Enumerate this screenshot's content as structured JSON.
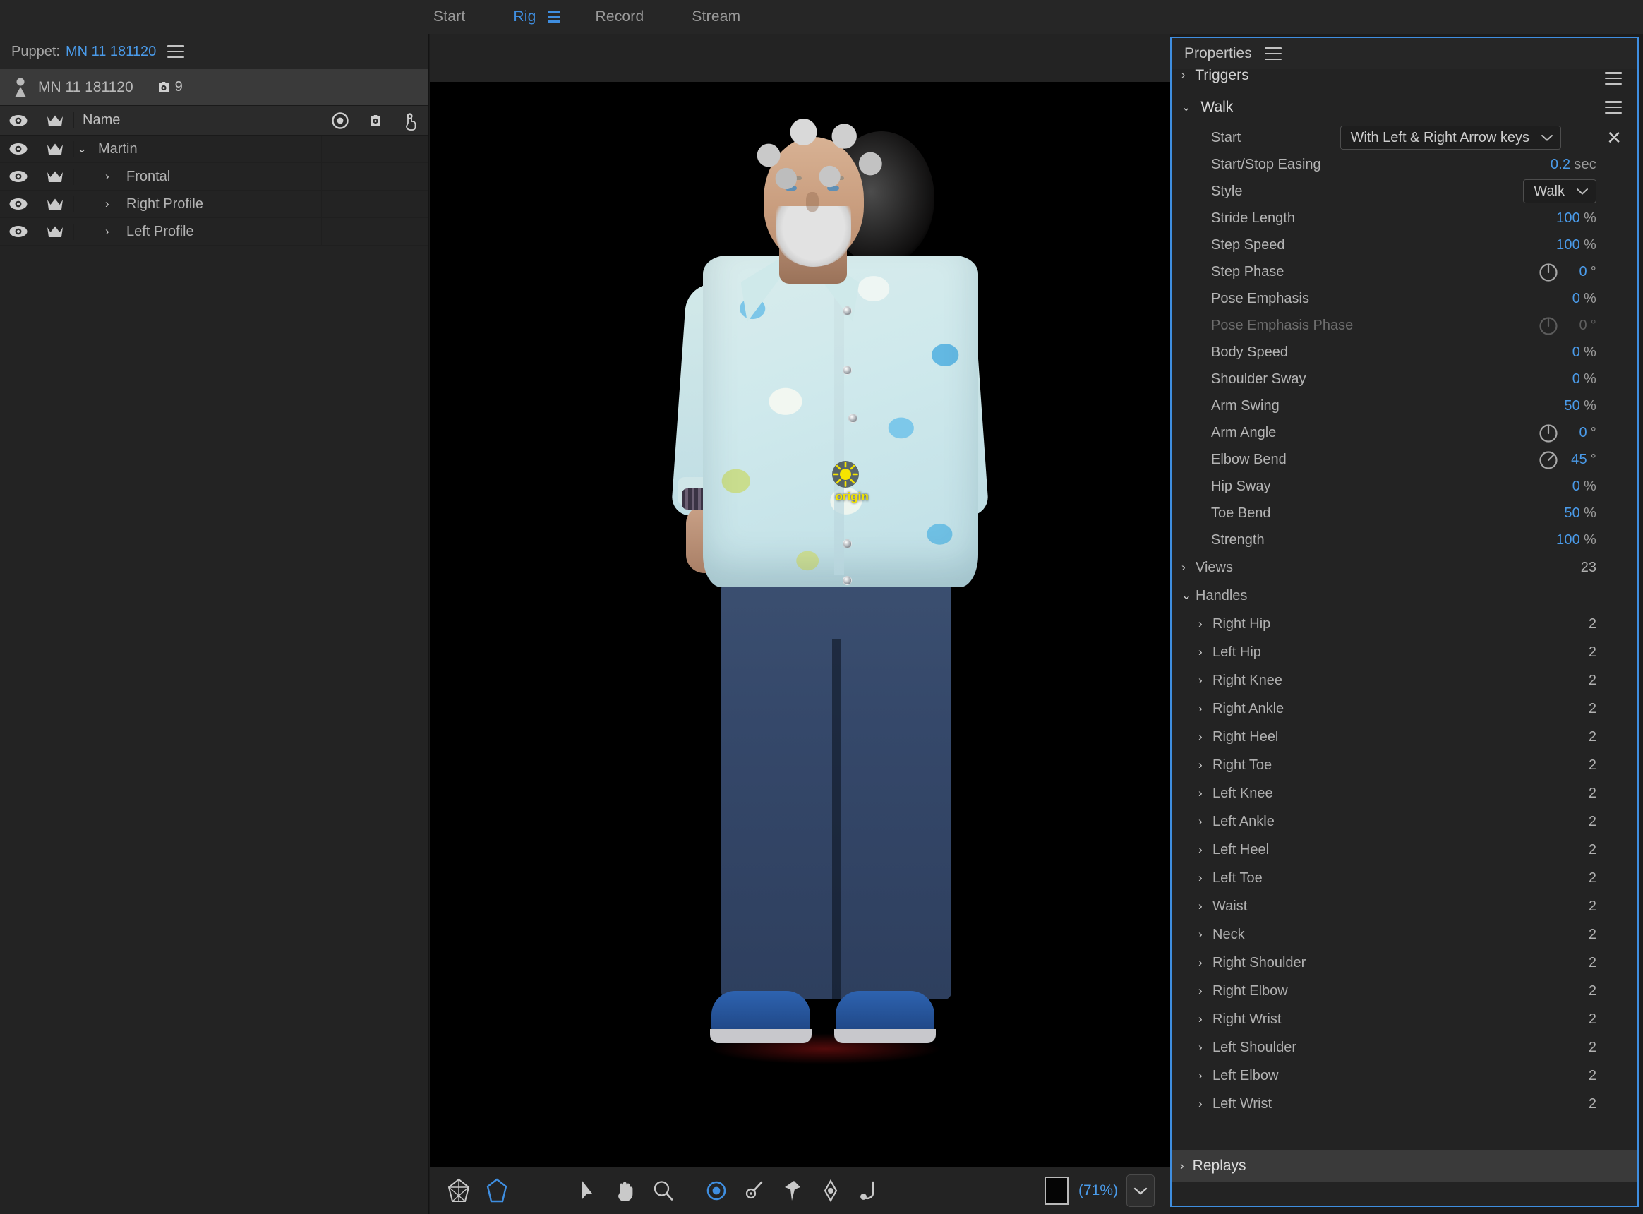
{
  "workspace": {
    "tabs": [
      {
        "label": "Start",
        "active": false
      },
      {
        "label": "Rig",
        "active": true
      },
      {
        "label": "Record",
        "active": false
      },
      {
        "label": "Stream",
        "active": false
      }
    ],
    "menu_icon": "hamburger-icon"
  },
  "puppet_panel": {
    "header_label": "Puppet:",
    "header_name": "MN 11 181120",
    "header_menu_icon": "hamburger-icon",
    "selected_puppet": "MN 11 181120",
    "tag_count": "9",
    "tag_icon": "tag-icon",
    "columns": {
      "eye": "eye-icon",
      "crown": "crown-icon",
      "name": "Name",
      "origin": "origin-icon",
      "tag": "tag-icon",
      "draggable": "draggable-icon"
    },
    "rows": [
      {
        "label": "Martin",
        "level": 1,
        "expanded": true
      },
      {
        "label": "Frontal",
        "level": 2,
        "expanded": false
      },
      {
        "label": "Right Profile",
        "level": 2,
        "expanded": false
      },
      {
        "label": "Left Profile",
        "level": 2,
        "expanded": false
      }
    ]
  },
  "stage": {
    "origin_label": "origin",
    "background_color": "#000000",
    "toolbar": {
      "mesh_icon": "mesh-icon",
      "outline_icon": "outline-icon",
      "select_icon": "arrow-select-icon",
      "hand_icon": "hand-icon",
      "zoom_icon": "magnifier-icon",
      "handle_icon": "handle-icon",
      "dangle_icon": "dangle-pin-icon",
      "stick_icon": "stick-pin-icon",
      "draggable_icon": "draggable-handle-icon",
      "staple_icon": "staple-icon",
      "bg_swatch": "background-color-swatch",
      "zoom_level": "(71%)",
      "zoom_menu_icon": "chevron-down-icon"
    }
  },
  "properties": {
    "title": "Properties",
    "menu_icon": "hamburger-icon",
    "triggers_section": {
      "label": "Triggers",
      "expanded": false
    },
    "walk": {
      "label": "Walk",
      "expanded": true,
      "menu_icon": "hamburger-icon",
      "start": {
        "label": "Start",
        "value": "With Left & Right Arrow keys",
        "chevron": "chevron-down-icon",
        "remove": "close-icon"
      },
      "params": [
        {
          "label": "Start/Stop Easing",
          "value": "0.2",
          "unit": "sec",
          "dial": false,
          "dim": false
        },
        {
          "label": "Style",
          "value": "Walk",
          "unit": "",
          "dial": false,
          "dim": false,
          "is_select": true
        },
        {
          "label": "Stride Length",
          "value": "100",
          "unit": "%",
          "dial": false,
          "dim": false
        },
        {
          "label": "Step Speed",
          "value": "100",
          "unit": "%",
          "dial": false,
          "dim": false
        },
        {
          "label": "Step Phase",
          "value": "0",
          "unit": "°",
          "dial": true,
          "dial_angle": 0,
          "dim": false
        },
        {
          "label": "Pose Emphasis",
          "value": "0",
          "unit": "%",
          "dial": false,
          "dim": false
        },
        {
          "label": "Pose Emphasis Phase",
          "value": "0",
          "unit": "°",
          "dial": true,
          "dial_angle": 0,
          "dim": true
        },
        {
          "label": "Body Speed",
          "value": "0",
          "unit": "%",
          "dial": false,
          "dim": false
        },
        {
          "label": "Shoulder Sway",
          "value": "0",
          "unit": "%",
          "dial": false,
          "dim": false
        },
        {
          "label": "Arm Swing",
          "value": "50",
          "unit": "%",
          "dial": false,
          "dim": false
        },
        {
          "label": "Arm Angle",
          "value": "0",
          "unit": "°",
          "dial": true,
          "dial_angle": 0,
          "dim": false
        },
        {
          "label": "Elbow Bend",
          "value": "45",
          "unit": "°",
          "dial": true,
          "dial_angle": 45,
          "dim": false
        },
        {
          "label": "Hip Sway",
          "value": "0",
          "unit": "%",
          "dial": false,
          "dim": false
        },
        {
          "label": "Toe Bend",
          "value": "50",
          "unit": "%",
          "dial": false,
          "dim": false
        },
        {
          "label": "Strength",
          "value": "100",
          "unit": "%",
          "dial": false,
          "dim": false
        }
      ],
      "views": {
        "label": "Views",
        "count": "23",
        "expanded": false
      },
      "handles": {
        "label": "Handles",
        "expanded": true,
        "items": [
          {
            "label": "Right Hip",
            "count": "2"
          },
          {
            "label": "Left Hip",
            "count": "2"
          },
          {
            "label": "Right Knee",
            "count": "2"
          },
          {
            "label": "Right Ankle",
            "count": "2"
          },
          {
            "label": "Right Heel",
            "count": "2"
          },
          {
            "label": "Right Toe",
            "count": "2"
          },
          {
            "label": "Left Knee",
            "count": "2"
          },
          {
            "label": "Left Ankle",
            "count": "2"
          },
          {
            "label": "Left Heel",
            "count": "2"
          },
          {
            "label": "Left Toe",
            "count": "2"
          },
          {
            "label": "Waist",
            "count": "2"
          },
          {
            "label": "Neck",
            "count": "2"
          },
          {
            "label": "Right Shoulder",
            "count": "2"
          },
          {
            "label": "Right Elbow",
            "count": "2"
          },
          {
            "label": "Right Wrist",
            "count": "2"
          },
          {
            "label": "Left Shoulder",
            "count": "2"
          },
          {
            "label": "Left Elbow",
            "count": "2"
          },
          {
            "label": "Left Wrist",
            "count": "2"
          }
        ]
      }
    },
    "replays_section": {
      "label": "Replays",
      "expanded": false
    }
  },
  "colors": {
    "accent_blue": "#4a9bea",
    "panel_bg": "#232323",
    "header_bg": "#262626",
    "selection_bg": "#3a3a3a",
    "focus_border": "#3f8ee0"
  }
}
